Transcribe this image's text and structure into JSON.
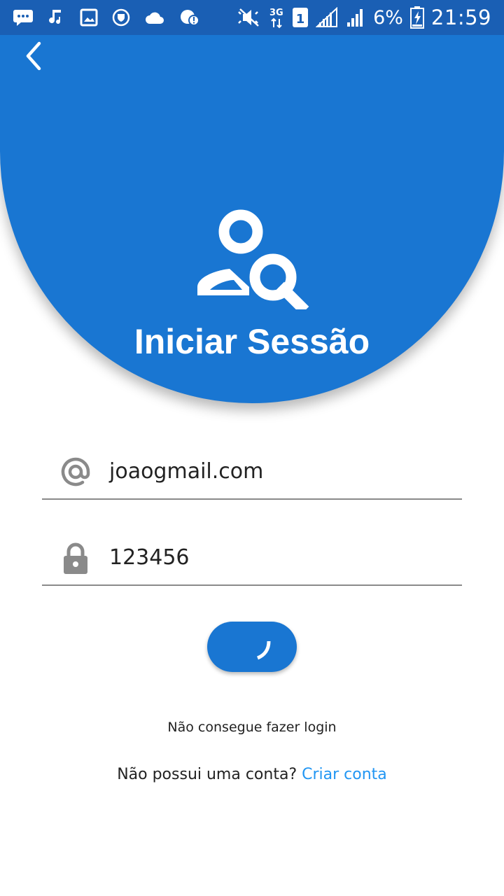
{
  "status_bar": {
    "battery_percent": "6%",
    "time": "21:59",
    "network_type": "3G",
    "sim_slot": "1",
    "left_icons": [
      "messaging-icon",
      "music-icon",
      "gallery-icon",
      "vpn-shield-icon",
      "cloud-icon",
      "alert-icon"
    ],
    "right_icons": [
      "mute-icon",
      "network-3g-icon",
      "sim-1-icon",
      "signal-icon",
      "signal-icon-2",
      "battery-charging-icon"
    ]
  },
  "header": {
    "back_icon": "chevron-left-icon",
    "icon": "user-search-icon",
    "title": "Iniciar Sessão"
  },
  "form": {
    "email": {
      "icon": "at-sign-icon",
      "value": "joaogmail.com"
    },
    "password": {
      "icon": "lock-icon",
      "value": "123456"
    },
    "submit": {
      "state": "loading",
      "icon": "spinner-icon"
    }
  },
  "links": {
    "forgot_password": "Não consegue fazer login",
    "no_account": "Não possui uma conta?",
    "create_account": "Criar conta"
  },
  "colors": {
    "primary": "#1976d2",
    "status_bar": "#1a5fb4",
    "link": "#2196f3",
    "text": "#222222",
    "icon_gray": "#8a8a8a"
  }
}
